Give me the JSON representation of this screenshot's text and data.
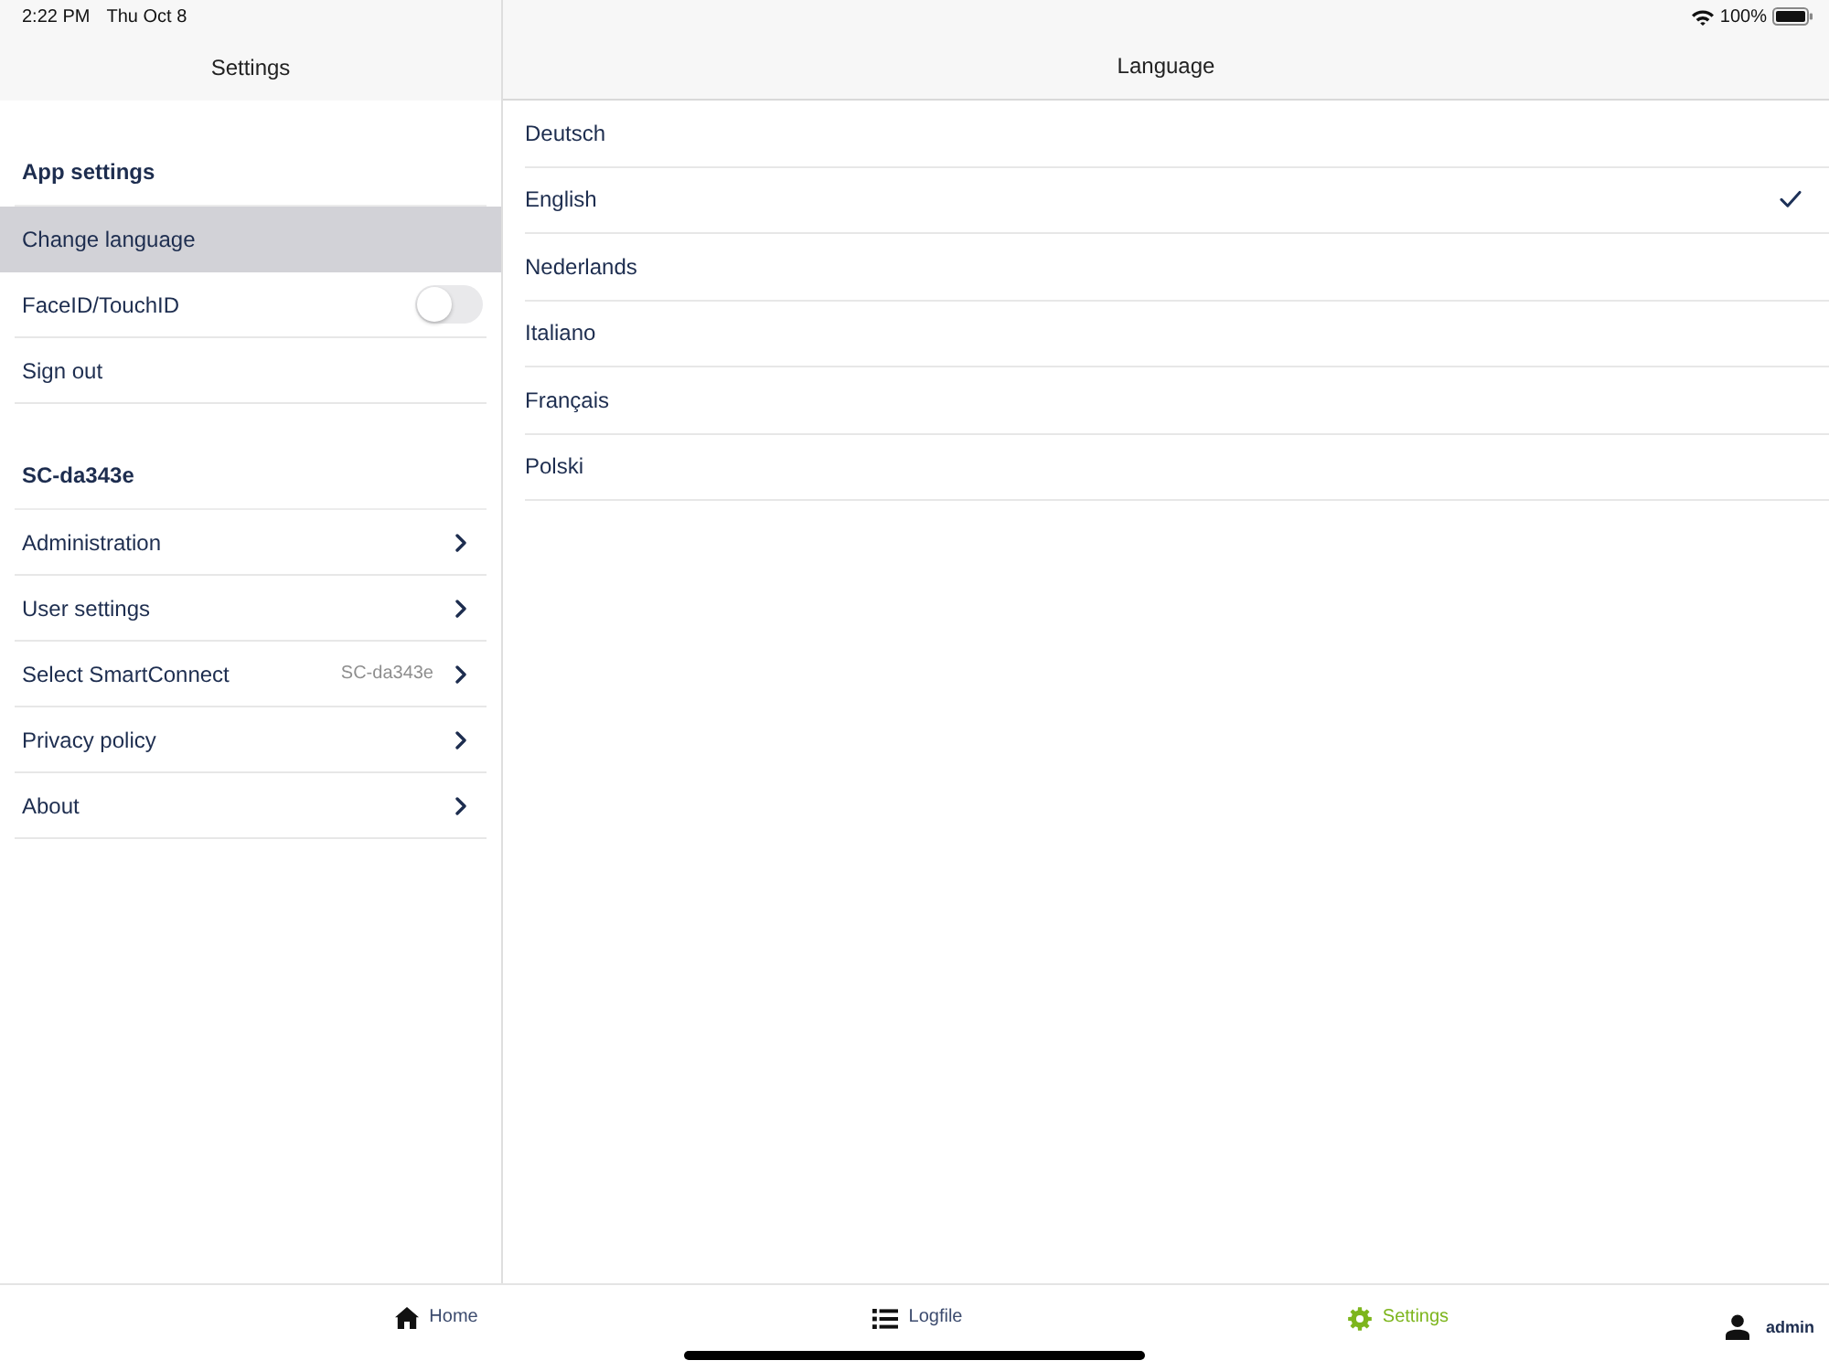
{
  "status_bar": {
    "time": "2:22 PM",
    "date": "Thu Oct 8",
    "battery": "100%"
  },
  "sidebar": {
    "title": "Settings",
    "sections": [
      {
        "title": "App settings",
        "items": [
          {
            "kind": "plain",
            "label": "Change language",
            "selected": true
          },
          {
            "kind": "toggle",
            "label": "FaceID/TouchID",
            "selected": false,
            "on": false
          },
          {
            "kind": "plain",
            "label": "Sign out",
            "selected": false
          }
        ]
      },
      {
        "title": "SC-da343e",
        "items": [
          {
            "kind": "disclosure",
            "label": "Administration",
            "selected": false
          },
          {
            "kind": "disclosure",
            "label": "User settings",
            "selected": false
          },
          {
            "kind": "disclosure",
            "label": "Select SmartConnect",
            "detail": "SC-da343e",
            "selected": false
          },
          {
            "kind": "disclosure",
            "label": "Privacy policy",
            "selected": false
          },
          {
            "kind": "disclosure",
            "label": "About",
            "selected": false
          }
        ]
      }
    ]
  },
  "detail": {
    "title": "Language",
    "options": [
      {
        "label": "Deutsch",
        "selected": false
      },
      {
        "label": "English",
        "selected": true
      },
      {
        "label": "Nederlands",
        "selected": false
      },
      {
        "label": "Italiano",
        "selected": false
      },
      {
        "label": "Français",
        "selected": false
      },
      {
        "label": "Polski",
        "selected": false
      }
    ]
  },
  "tab_bar": {
    "tabs": [
      {
        "kind": "home",
        "label": "Home",
        "selected": false
      },
      {
        "kind": "list",
        "label": "Logfile",
        "selected": false
      },
      {
        "kind": "gear",
        "label": "Settings",
        "selected": true
      }
    ],
    "user": "admin"
  }
}
